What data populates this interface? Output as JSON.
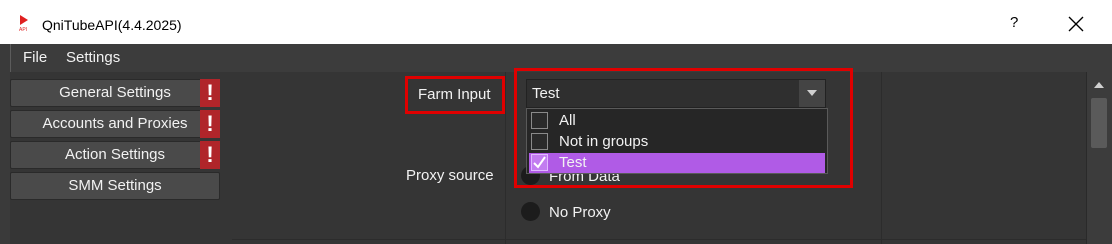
{
  "window": {
    "title": "QniTubeAPI(4.4.2025)",
    "help_label": "?",
    "app_icon": "youtube-api-icon",
    "close_icon": "close-icon"
  },
  "menu": {
    "items": [
      "File",
      "Settings"
    ]
  },
  "sidebar": {
    "items": [
      {
        "label": "General Settings",
        "warning": "!"
      },
      {
        "label": "Accounts and Proxies",
        "warning": "!"
      },
      {
        "label": "Action Settings",
        "warning": "!"
      },
      {
        "label": "SMM Settings"
      }
    ]
  },
  "form": {
    "farm_input_label": "Farm Input",
    "farm_input_value": "Test",
    "farm_input_options": [
      {
        "label": "All",
        "checked": false
      },
      {
        "label": "Not in groups",
        "checked": false
      },
      {
        "label": "Test",
        "checked": true,
        "selected": true
      }
    ],
    "proxy_source_label": "Proxy source",
    "proxy_options": [
      "From Data",
      "No Proxy"
    ]
  },
  "colors": {
    "highlight": "#e00000",
    "selection": "#b05be6",
    "warning": "#b0252a"
  }
}
